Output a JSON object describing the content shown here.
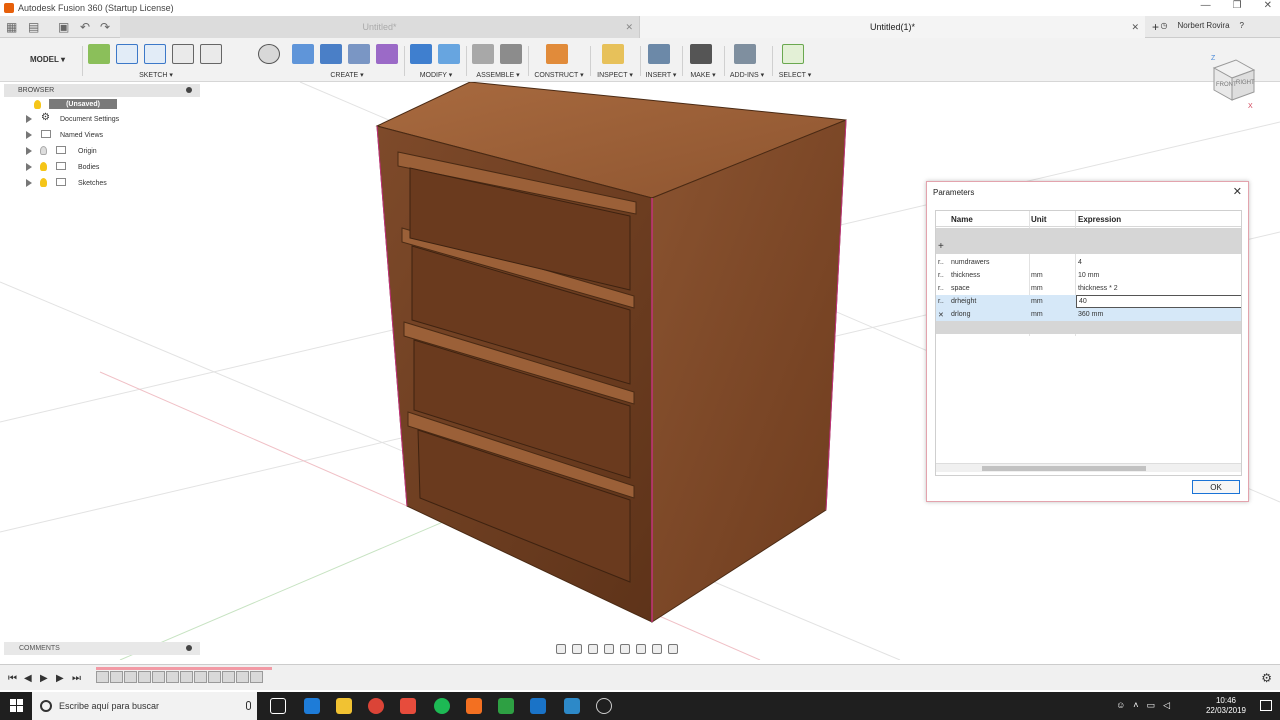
{
  "window": {
    "title": "Autodesk Fusion 360 (Startup License)",
    "controls": [
      "—",
      "❐",
      "✕"
    ]
  },
  "tabs": [
    {
      "label": "Untitled*",
      "active": false
    },
    {
      "label": "Untitled(1)*",
      "active": true
    }
  ],
  "user": {
    "name": "Norbert Rovira",
    "help": "?"
  },
  "toolbar": {
    "workspace": "MODEL ▾",
    "groups": [
      {
        "label": "SKETCH ▾"
      },
      {
        "label": "CREATE ▾"
      },
      {
        "label": "MODIFY ▾"
      },
      {
        "label": "ASSEMBLE ▾"
      },
      {
        "label": "CONSTRUCT ▾"
      },
      {
        "label": "INSPECT ▾"
      },
      {
        "label": "INSERT ▾"
      },
      {
        "label": "MAKE ▾"
      },
      {
        "label": "ADD-INS ▾"
      },
      {
        "label": "SELECT ▾"
      }
    ]
  },
  "browser": {
    "title": "BROWSER",
    "root": "(Unsaved)",
    "items": [
      {
        "label": "Document Settings",
        "icon": "gear-icon"
      },
      {
        "label": "Named Views",
        "icon": "folder-icon"
      },
      {
        "label": "Origin",
        "icon": "folder-icon"
      },
      {
        "label": "Bodies",
        "icon": "folder-icon"
      },
      {
        "label": "Sketches",
        "icon": "folder-icon"
      }
    ]
  },
  "viewcube": {
    "front": "FRONT",
    "right": "RIGHT",
    "axis_z": "Z",
    "axis_x": "X"
  },
  "comments": {
    "label": "COMMENTS"
  },
  "parameters_dialog": {
    "title": "Parameters",
    "columns": {
      "name": "Name",
      "unit": "Unit",
      "expression": "Expression"
    },
    "rows": [
      {
        "prefix": "r..",
        "name": "numdrawers",
        "unit": "",
        "expression": "4"
      },
      {
        "prefix": "r..",
        "name": "thickness",
        "unit": "mm",
        "expression": "10 mm"
      },
      {
        "prefix": "r..",
        "name": "space",
        "unit": "mm",
        "expression": "thickness * 2"
      },
      {
        "prefix": "r..",
        "name": "drheight",
        "unit": "mm",
        "expression": "40"
      },
      {
        "prefix": "✕",
        "name": "drlong",
        "unit": "mm",
        "expression": "360 mm"
      }
    ],
    "ok_label": "OK"
  },
  "taskbar": {
    "search_placeholder": "Escribe aquí para buscar",
    "time": "10:46",
    "date": "22/03/2019"
  }
}
